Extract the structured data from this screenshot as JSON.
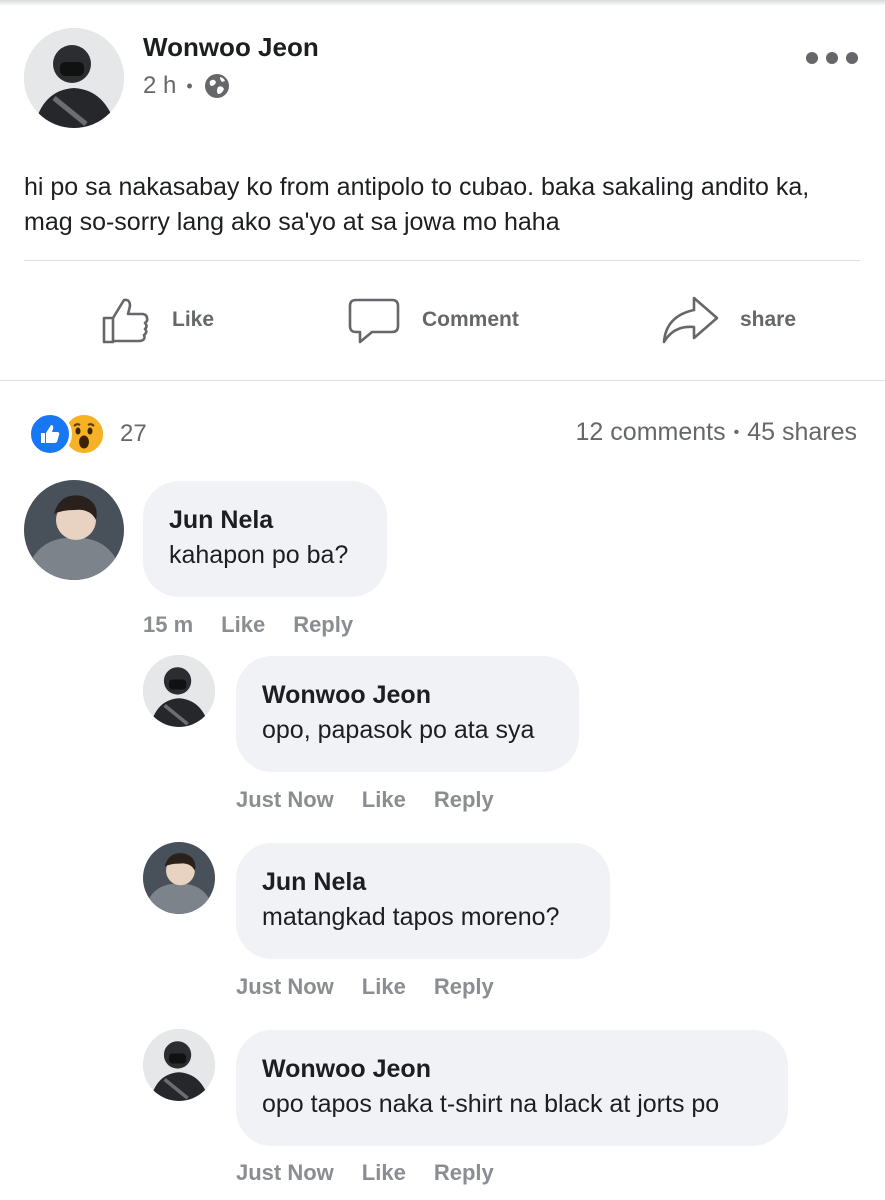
{
  "post": {
    "author": "Wonwoo Jeon",
    "time": "2 h",
    "separator": "•",
    "privacy_icon": "globe-icon",
    "more_icon": "more-horizontal-icon",
    "text": "hi po sa nakasabay ko from antipolo to cubao. baka sakaling andito ka, mag so-sorry lang ako sa'yo at sa jowa mo haha"
  },
  "actions": {
    "like": "Like",
    "comment": "Comment",
    "share": "share"
  },
  "reactions": {
    "icons": [
      "like-reaction-icon",
      "wow-reaction-icon"
    ],
    "count": "27",
    "comments": "12 comments",
    "separator": "•",
    "shares": "45 shares"
  },
  "comments": [
    {
      "author": "Jun Nela",
      "text": "kahapon po ba?",
      "time": "15 m",
      "like": "Like",
      "reply": "Reply"
    },
    {
      "author": "Wonwoo Jeon",
      "text": "opo, papasok po ata sya",
      "time": "Just Now",
      "like": "Like",
      "reply": "Reply"
    },
    {
      "author": "Jun Nela",
      "text": "matangkad tapos moreno?",
      "time": "Just Now",
      "like": "Like",
      "reply": "Reply"
    },
    {
      "author": "Wonwoo Jeon",
      "text": "opo tapos naka t-shirt na black at jorts po",
      "time": "Just Now",
      "like": "Like",
      "reply": "Reply"
    }
  ],
  "colors": {
    "text_primary": "#1c1e21",
    "text_secondary": "#65676b",
    "comment_bubble": "#f0f2f5",
    "like_blue": "#1877f2",
    "wow_yellow": "#f7b125"
  }
}
